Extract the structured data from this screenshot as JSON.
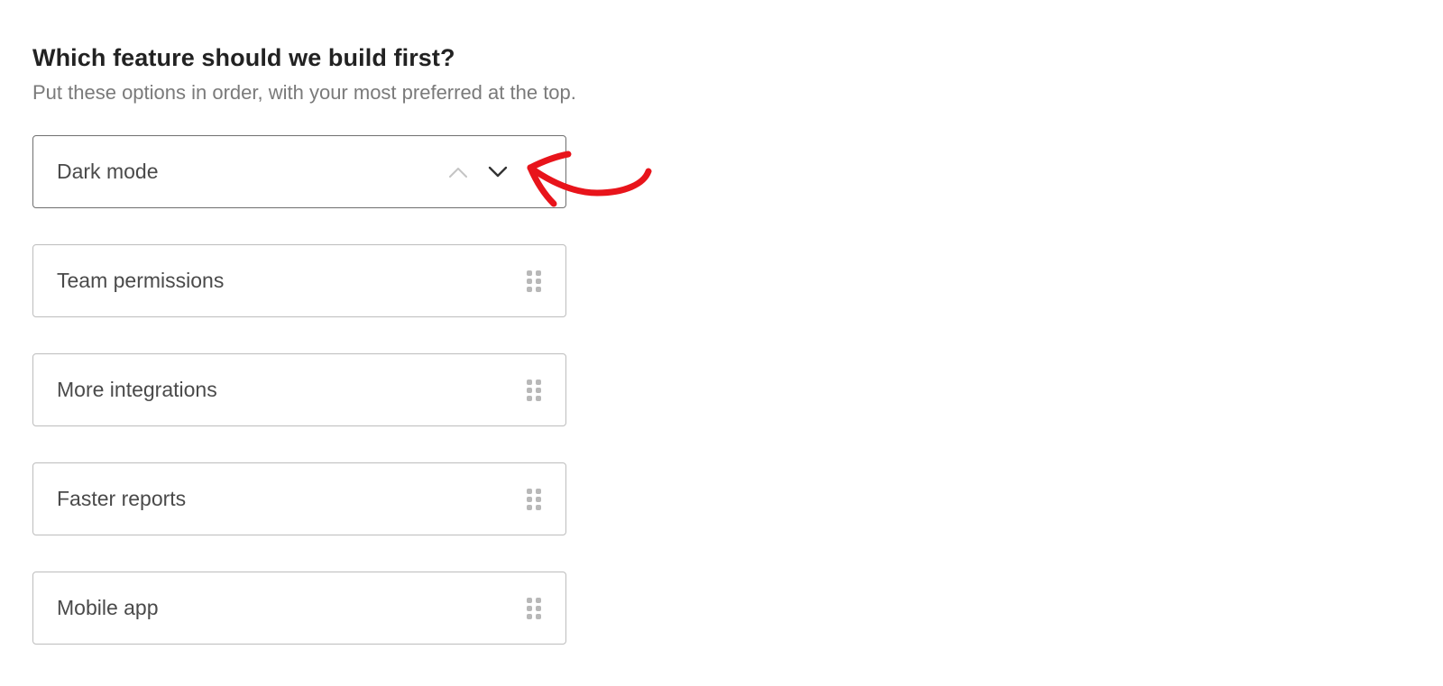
{
  "question": {
    "title": "Which feature should we build first?",
    "hint": "Put these options in order, with your most preferred at the top."
  },
  "options": [
    {
      "label": "Dark mode",
      "state": "active",
      "controls": [
        "move-up-icon",
        "move-down-icon"
      ]
    },
    {
      "label": "Team permissions",
      "state": "idle",
      "controls": [
        "drag-handle-icon"
      ]
    },
    {
      "label": "More integrations",
      "state": "idle",
      "controls": [
        "drag-handle-icon"
      ]
    },
    {
      "label": "Faster reports",
      "state": "idle",
      "controls": [
        "drag-handle-icon"
      ]
    },
    {
      "label": "Mobile app",
      "state": "idle",
      "controls": [
        "drag-handle-icon"
      ]
    }
  ],
  "colors": {
    "title": "#222222",
    "hint": "#7a7a7a",
    "option_border": "#bdbdbd",
    "option_border_active": "#6f6f6f",
    "arrow_disabled": "#c4c4c4",
    "arrow_enabled": "#333333",
    "handle": "#b8b8b8",
    "annotation": "#e8141b"
  },
  "annotation": {
    "icon": "hand-drawn-arrow-icon"
  }
}
